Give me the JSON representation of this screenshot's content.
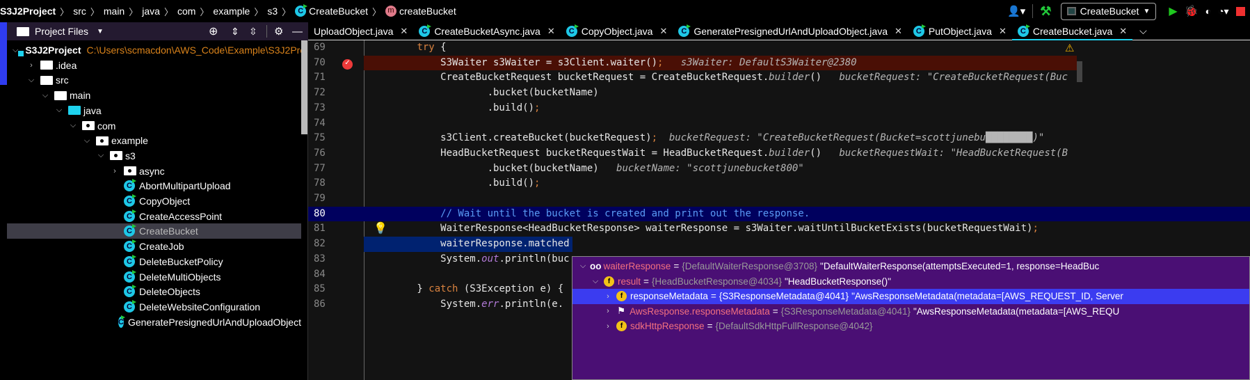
{
  "breadcrumb": {
    "items": [
      "S3J2Project",
      "src",
      "main",
      "java",
      "com",
      "example",
      "s3",
      "CreateBucket",
      "createBucket"
    ]
  },
  "toolbar": {
    "run_config": "CreateBucket",
    "icons": [
      "user-icon",
      "build-hammer-icon",
      "run-icon",
      "debug-icon",
      "coverage-icon",
      "profile-icon",
      "stop-icon"
    ],
    "colors": {
      "run": "#1fc81f",
      "stop": "#f03030",
      "build": "#22c93a"
    }
  },
  "sidebar": {
    "title": "Project Files",
    "tree": [
      {
        "label": "S3J2Project",
        "path": "C:\\Users\\scmacdon\\AWS_Code\\Example\\S3J2Proje",
        "depth": 0,
        "icon": "project",
        "chev": "down"
      },
      {
        "label": ".idea",
        "depth": 1,
        "icon": "folder",
        "chev": "right"
      },
      {
        "label": "src",
        "depth": 1,
        "icon": "folder",
        "chev": "down"
      },
      {
        "label": "main",
        "depth": 2,
        "icon": "folder",
        "chev": "down"
      },
      {
        "label": "java",
        "depth": 3,
        "icon": "source-folder",
        "chev": "down"
      },
      {
        "label": "com",
        "depth": 4,
        "icon": "package",
        "chev": "down"
      },
      {
        "label": "example",
        "depth": 5,
        "icon": "package",
        "chev": "down"
      },
      {
        "label": "s3",
        "depth": 6,
        "icon": "package",
        "chev": "down"
      },
      {
        "label": "async",
        "depth": 7,
        "icon": "package",
        "chev": "right"
      },
      {
        "label": "AbortMultipartUpload",
        "depth": 7,
        "icon": "class"
      },
      {
        "label": "CopyObject",
        "depth": 7,
        "icon": "class"
      },
      {
        "label": "CreateAccessPoint",
        "depth": 7,
        "icon": "class"
      },
      {
        "label": "CreateBucket",
        "depth": 7,
        "icon": "class",
        "selected": true
      },
      {
        "label": "CreateJob",
        "depth": 7,
        "icon": "class"
      },
      {
        "label": "DeleteBucketPolicy",
        "depth": 7,
        "icon": "class"
      },
      {
        "label": "DeleteMultiObjects",
        "depth": 7,
        "icon": "class"
      },
      {
        "label": "DeleteObjects",
        "depth": 7,
        "icon": "class"
      },
      {
        "label": "DeleteWebsiteConfiguration",
        "depth": 7,
        "icon": "class"
      },
      {
        "label": "GeneratePresignedUrlAndUploadObject",
        "depth": 7,
        "icon": "class"
      }
    ]
  },
  "tabs": [
    {
      "label": "UploadObject.java",
      "icon": false
    },
    {
      "label": "CreateBucketAsync.java",
      "icon": true
    },
    {
      "label": "CopyObject.java",
      "icon": true
    },
    {
      "label": "GeneratePresignedUrlAndUploadObject.java",
      "icon": true
    },
    {
      "label": "PutObject.java",
      "icon": true
    },
    {
      "label": "CreateBucket.java",
      "icon": true,
      "active": true
    }
  ],
  "editor": {
    "lines": [
      {
        "num": "69",
        "seg": [
          [
            "        ",
            ""
          ],
          [
            "try",
            "kw"
          ],
          [
            " {",
            ""
          ]
        ]
      },
      {
        "num": "70",
        "hl": "break",
        "seg": [
          [
            "            S3Waiter s3Waiter = s3Client.waiter()",
            ""
          ],
          [
            ";",
            "semi"
          ],
          [
            "   s3Waiter: DefaultS3Waiter@2380",
            "hint"
          ]
        ]
      },
      {
        "num": "71",
        "seg": [
          [
            "            CreateBucketRequest bucketRequest = CreateBucketRequest.",
            ""
          ],
          [
            "builder",
            "hint"
          ],
          [
            "()",
            ""
          ],
          [
            "   bucketRequest: \"CreateBucketRequest(Buc",
            "hint"
          ]
        ]
      },
      {
        "num": "72",
        "seg": [
          [
            "                    .bucket(bucketName)",
            ""
          ]
        ]
      },
      {
        "num": "73",
        "seg": [
          [
            "                    .build()",
            ""
          ],
          [
            ";",
            "semi"
          ]
        ]
      },
      {
        "num": "74",
        "seg": []
      },
      {
        "num": "75",
        "seg": [
          [
            "            s3Client.createBucket(bucketRequest)",
            ""
          ],
          [
            ";",
            "semi"
          ],
          [
            "  bucketRequest: \"CreateBucketRequest(Bucket=scottjunebu",
            "hint"
          ],
          [
            "████████",
            "hint"
          ],
          [
            ")\"",
            "hint"
          ]
        ]
      },
      {
        "num": "76",
        "seg": [
          [
            "            HeadBucketRequest bucketRequestWait = HeadBucketRequest.",
            ""
          ],
          [
            "builder",
            "hint"
          ],
          [
            "()",
            ""
          ],
          [
            "   bucketRequestWait: \"HeadBucketRequest(B",
            "hint"
          ]
        ]
      },
      {
        "num": "77",
        "seg": [
          [
            "                    .bucket(bucketName)",
            ""
          ],
          [
            "   bucketName: \"scottjunebucket800\"",
            "hint"
          ]
        ]
      },
      {
        "num": "78",
        "seg": [
          [
            "                    .build()",
            ""
          ],
          [
            ";",
            "semi"
          ]
        ]
      },
      {
        "num": "79",
        "seg": []
      },
      {
        "num": "80",
        "hl": "current",
        "seg": [
          [
            "            // Wait until the bucket is created and print out the response.",
            "cm"
          ]
        ]
      },
      {
        "num": "81",
        "seg": [
          [
            "            WaiterResponse<HeadBucketResponse> waiterResponse = s3Waiter.waitUntilBucketExists(bucketRequestWait)",
            ""
          ],
          [
            ";",
            "semi"
          ]
        ]
      },
      {
        "num": "82",
        "hl": "sel",
        "seg": [
          [
            "            waiterResponse.matched",
            ""
          ]
        ]
      },
      {
        "num": "83",
        "seg": [
          [
            "            System.",
            ""
          ],
          [
            "out",
            "fld"
          ],
          [
            ".println(buc",
            ""
          ]
        ]
      },
      {
        "num": "84",
        "seg": []
      },
      {
        "num": "85",
        "seg": [
          [
            "        } ",
            ""
          ],
          [
            "catch",
            "kw"
          ],
          [
            " (S3Exception e) {",
            ""
          ]
        ]
      },
      {
        "num": "86",
        "seg": [
          [
            "            System.",
            ""
          ],
          [
            "err",
            "fld"
          ],
          [
            ".println(e.",
            ""
          ]
        ]
      }
    ]
  },
  "debug_popup": {
    "rows": [
      {
        "indent": 0,
        "icon": "watch-glasses",
        "name": "waiterResponse",
        "type": "{DefaultWaiterResponse@3708}",
        "value": "\"DefaultWaiterResponse(attemptsExecuted=1, response=HeadBuc"
      },
      {
        "indent": 1,
        "icon": "field",
        "name": "result",
        "type": "{HeadBucketResponse@4034}",
        "value": "\"HeadBucketResponse()\"",
        "chev": "down"
      },
      {
        "indent": 2,
        "icon": "field",
        "name": "responseMetadata",
        "type": "{S3ResponseMetadata@4041}",
        "value": "\"AwsResponseMetadata(metadata=[AWS_REQUEST_ID, Server",
        "selected": true
      },
      {
        "indent": 2,
        "icon": "flag",
        "name": "AwsResponse.responseMetadata",
        "type": "{S3ResponseMetadata@4041}",
        "value": "\"AwsResponseMetadata(metadata=[AWS_REQU"
      },
      {
        "indent": 2,
        "icon": "field",
        "name": "sdkHttpResponse",
        "type": "{DefaultSdkHttpFullResponse@4042}",
        "value": ""
      }
    ]
  }
}
